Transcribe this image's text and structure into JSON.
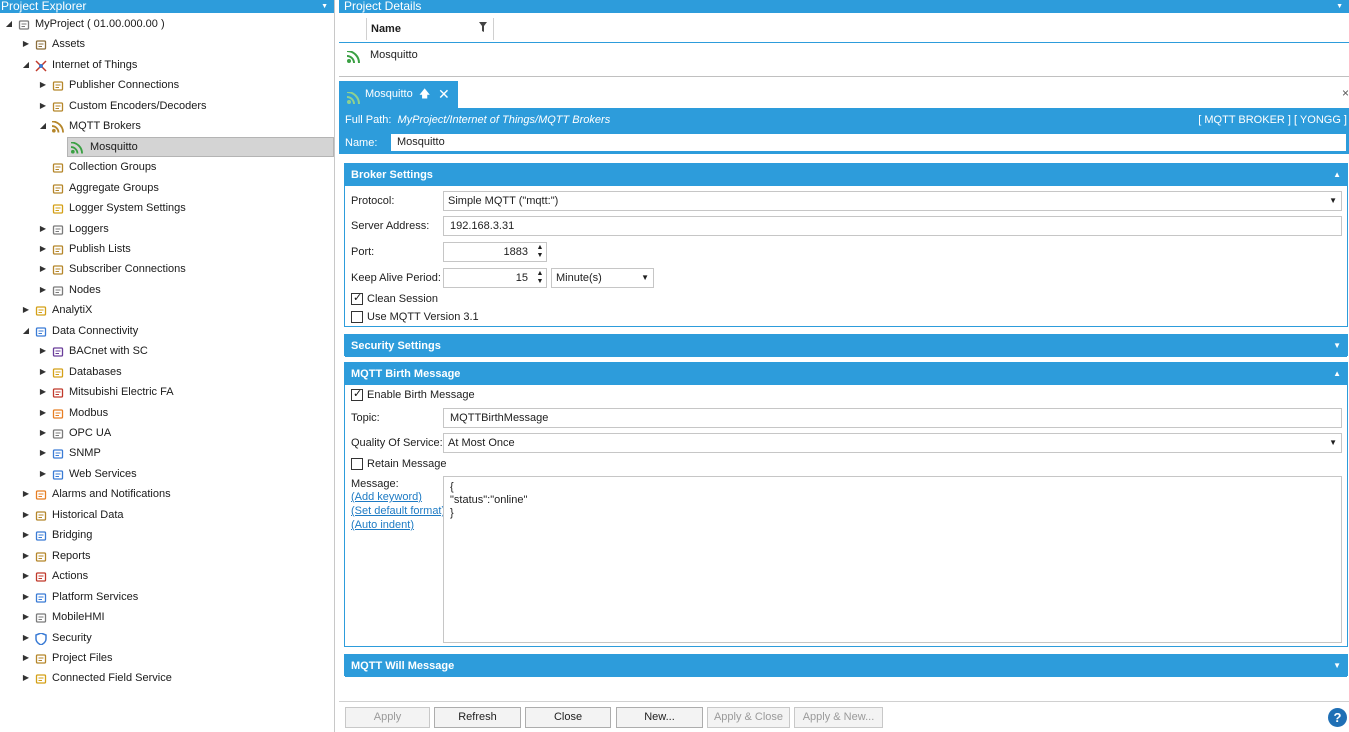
{
  "explorer": {
    "title": "Project Explorer",
    "tree": [
      {
        "label": "MyProject ( 01.00.000.00 )",
        "level": 0,
        "state": "open",
        "icon": "project-file-icon",
        "color": "#7a7a7a"
      },
      {
        "label": "Assets",
        "level": 1,
        "state": "closed",
        "icon": "assets-icon",
        "color": "#8a6d3b"
      },
      {
        "label": "Internet of Things",
        "level": 1,
        "state": "open",
        "icon": "iot-icon",
        "color": "#c0392b"
      },
      {
        "label": "Publisher Connections",
        "level": 2,
        "state": "closed",
        "icon": "publisher-icon",
        "color": "#b5862a"
      },
      {
        "label": "Custom Encoders/Decoders",
        "level": 2,
        "state": "closed",
        "icon": "encoder-icon",
        "color": "#b5862a"
      },
      {
        "label": "MQTT Brokers",
        "level": 2,
        "state": "open",
        "icon": "rss-icon",
        "color": "#b5862a"
      },
      {
        "label": "Mosquitto",
        "level": 3,
        "state": "none",
        "icon": "rss-icon",
        "color": "#3aa043",
        "selected": true
      },
      {
        "label": "Collection Groups",
        "level": 2,
        "state": "none",
        "icon": "collection-icon",
        "color": "#b5862a"
      },
      {
        "label": "Aggregate Groups",
        "level": 2,
        "state": "none",
        "icon": "aggregate-icon",
        "color": "#b5862a"
      },
      {
        "label": "Logger System Settings",
        "level": 2,
        "state": "none",
        "icon": "settings-icon",
        "color": "#d4a017"
      },
      {
        "label": "Loggers",
        "level": 2,
        "state": "closed",
        "icon": "loggers-icon",
        "color": "#7a7a7a"
      },
      {
        "label": "Publish Lists",
        "level": 2,
        "state": "closed",
        "icon": "publish-list-icon",
        "color": "#b5862a"
      },
      {
        "label": "Subscriber Connections",
        "level": 2,
        "state": "closed",
        "icon": "subscriber-icon",
        "color": "#b5862a"
      },
      {
        "label": "Nodes",
        "level": 2,
        "state": "closed",
        "icon": "nodes-icon",
        "color": "#7a7a7a"
      },
      {
        "label": "AnalytiX",
        "level": 1,
        "state": "closed",
        "icon": "analytix-icon",
        "color": "#d4a017"
      },
      {
        "label": "Data Connectivity",
        "level": 1,
        "state": "open",
        "icon": "connectivity-icon",
        "color": "#3a7bd5"
      },
      {
        "label": "BACnet with SC",
        "level": 2,
        "state": "closed",
        "icon": "bacnet-icon",
        "color": "#6a3d9a"
      },
      {
        "label": "Databases",
        "level": 2,
        "state": "closed",
        "icon": "database-icon",
        "color": "#d4a017"
      },
      {
        "label": "Mitsubishi Electric FA",
        "level": 2,
        "state": "closed",
        "icon": "mitsubishi-icon",
        "color": "#c0392b"
      },
      {
        "label": "Modbus",
        "level": 2,
        "state": "closed",
        "icon": "modbus-icon",
        "color": "#e67e22"
      },
      {
        "label": "OPC UA",
        "level": 2,
        "state": "closed",
        "icon": "opcua-icon",
        "color": "#7a7a7a"
      },
      {
        "label": "SNMP",
        "level": 2,
        "state": "closed",
        "icon": "snmp-icon",
        "color": "#3a7bd5"
      },
      {
        "label": "Web Services",
        "level": 2,
        "state": "closed",
        "icon": "web-services-icon",
        "color": "#3a7bd5"
      },
      {
        "label": "Alarms and Notifications",
        "level": 1,
        "state": "closed",
        "icon": "alarm-icon",
        "color": "#e67e22"
      },
      {
        "label": "Historical Data",
        "level": 1,
        "state": "closed",
        "icon": "historical-icon",
        "color": "#b5862a"
      },
      {
        "label": "Bridging",
        "level": 1,
        "state": "closed",
        "icon": "bridging-icon",
        "color": "#3a7bd5"
      },
      {
        "label": "Reports",
        "level": 1,
        "state": "closed",
        "icon": "reports-icon",
        "color": "#b5862a"
      },
      {
        "label": "Actions",
        "level": 1,
        "state": "closed",
        "icon": "actions-icon",
        "color": "#c0392b"
      },
      {
        "label": "Platform Services",
        "level": 1,
        "state": "closed",
        "icon": "platform-icon",
        "color": "#3a7bd5"
      },
      {
        "label": "MobileHMI",
        "level": 1,
        "state": "closed",
        "icon": "mobile-icon",
        "color": "#7a7a7a"
      },
      {
        "label": "Security",
        "level": 1,
        "state": "closed",
        "icon": "shield-icon",
        "color": "#3a7bd5"
      },
      {
        "label": "Project Files",
        "level": 1,
        "state": "closed",
        "icon": "project-files-icon",
        "color": "#b5862a"
      },
      {
        "label": "Connected Field Service",
        "level": 1,
        "state": "closed",
        "icon": "field-service-icon",
        "color": "#d4a017"
      }
    ]
  },
  "details": {
    "title": "Project Details",
    "column_name": "Name",
    "row_name": "Mosquitto"
  },
  "tab": {
    "label": "Mosquitto",
    "pin_icon": "pin-icon",
    "close_icon": "close-icon",
    "far_close": "×"
  },
  "info": {
    "full_path_label": "Full Path:",
    "full_path": "MyProject/Internet of Things/MQTT Brokers",
    "tags": "[ MQTT BROKER ] [ YONGG ]",
    "name_label": "Name:",
    "name_value": "Mosquitto"
  },
  "broker": {
    "title": "Broker Settings",
    "protocol_label": "Protocol:",
    "protocol_value": "Simple MQTT (\"mqtt:\")",
    "server_label": "Server Address:",
    "server_value": "192.168.3.31",
    "port_label": "Port:",
    "port_value": "1883",
    "keepalive_label": "Keep Alive Period:",
    "keepalive_value": "15",
    "keepalive_unit": "Minute(s)",
    "clean_session_label": "Clean Session",
    "clean_session_checked": true,
    "mqtt31_label": "Use MQTT Version 3.1",
    "mqtt31_checked": false
  },
  "security": {
    "title": "Security Settings"
  },
  "birth": {
    "title": "MQTT Birth Message",
    "enable_label": "Enable Birth Message",
    "enable_checked": true,
    "topic_label": "Topic:",
    "topic_value": "MQTTBirthMessage",
    "qos_label": "Quality Of Service:",
    "qos_value": "At Most Once",
    "retain_label": "Retain Message",
    "retain_checked": false,
    "message_label": "Message:",
    "add_keyword": "(Add keyword)",
    "set_default": "(Set default format)",
    "auto_indent": "(Auto indent)",
    "message_lines": [
      "{",
      "\"status\":\"online\"",
      "}"
    ]
  },
  "will": {
    "title": "MQTT Will Message"
  },
  "buttons": {
    "apply": "Apply",
    "refresh": "Refresh",
    "close": "Close",
    "new": "New...",
    "apply_close": "Apply & Close",
    "apply_new": "Apply & New...",
    "help": "?"
  },
  "colors": {
    "accent": "#2d9cdb",
    "selection": "#d4d4d4",
    "link": "#1e7bc4"
  }
}
